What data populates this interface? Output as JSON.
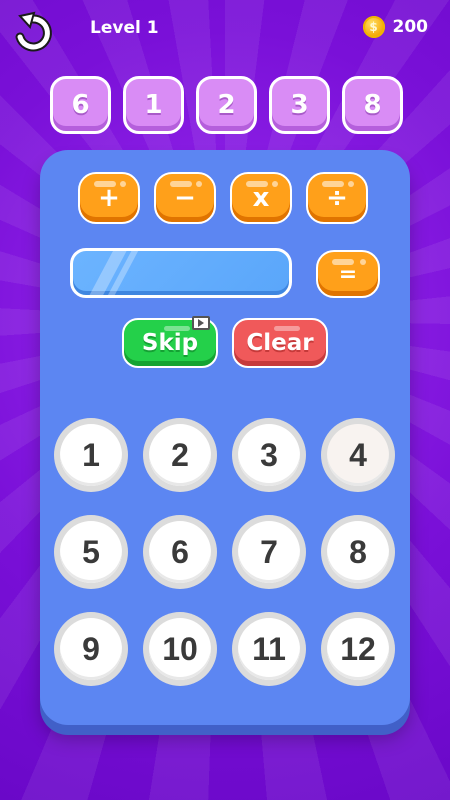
{
  "header": {
    "level_label": "Level 1",
    "coins": "200",
    "coin_symbol": "$"
  },
  "targets": [
    "6",
    "1",
    "2",
    "3",
    "8"
  ],
  "operators": [
    "+",
    "−",
    "x",
    "÷"
  ],
  "display": {
    "value": ""
  },
  "equals_label": "=",
  "skip_label": "Skip",
  "clear_label": "Clear",
  "numbers": [
    "1",
    "2",
    "3",
    "4",
    "5",
    "6",
    "7",
    "8",
    "9",
    "10",
    "11",
    "12"
  ],
  "colors": {
    "background": "#7a12d8",
    "board": "#5c86f2",
    "target_tile": "#d98cf5",
    "operator": "#ffa01a",
    "skip": "#24d04a",
    "clear": "#f0595a"
  }
}
